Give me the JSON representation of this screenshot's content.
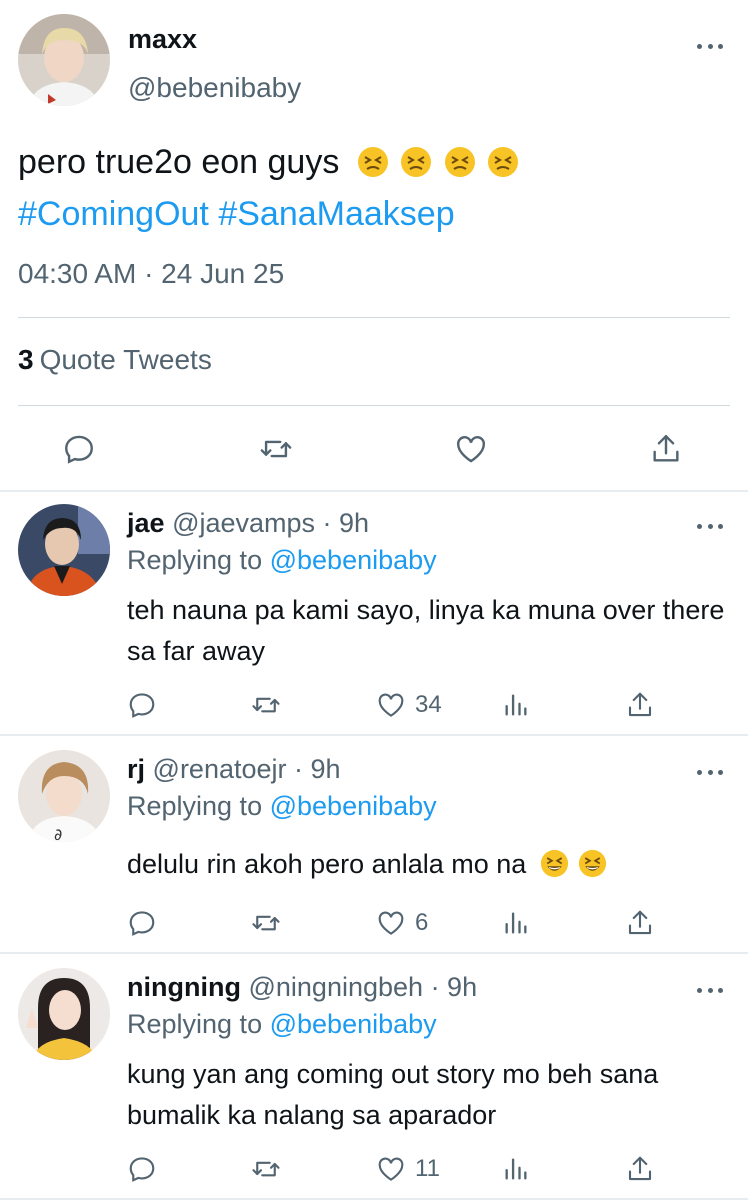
{
  "main_tweet": {
    "author_name": "maxx",
    "author_handle": "@bebenibaby",
    "text": "pero true2o eon guys",
    "emojis": [
      "persevering-face",
      "persevering-face",
      "persevering-face",
      "persevering-face"
    ],
    "hashtags": [
      "#ComingOut",
      "#SanaMaaksep"
    ],
    "timestamp": "04:30 AM · 24 Jun 25",
    "quote_count": "3",
    "quote_label": "Quote Tweets",
    "actions": [
      "reply-icon",
      "retweet-icon",
      "like-icon",
      "share-icon"
    ]
  },
  "replies": [
    {
      "name": "jae",
      "handle": "@jaevamps",
      "time": "· 9h",
      "replying_prefix": "Replying to",
      "replying_to": "@bebenibaby",
      "text": "teh nauna pa kami sayo, linya ka muna over there sa far away",
      "like_count": "34"
    },
    {
      "name": "rj",
      "handle": "@renatoejr",
      "time": "· 9h",
      "replying_prefix": "Replying to",
      "replying_to": "@bebenibaby",
      "text": "delulu rin akoh pero anlala mo na",
      "emojis": [
        "grinning-squinting-face",
        "grinning-squinting-face"
      ],
      "like_count": "6"
    },
    {
      "name": "ningning",
      "handle": "@ningningbeh",
      "time": "· 9h",
      "replying_prefix": "Replying to",
      "replying_to": "@bebenibaby",
      "text": "kung yan ang coming out story mo beh sana bumalik ka nalang sa aparador",
      "like_count": "11"
    }
  ],
  "colors": {
    "link": "#1d9bf0",
    "secondary_text": "#536471",
    "primary_text": "#0f1419",
    "divider": "#cfd9de"
  }
}
